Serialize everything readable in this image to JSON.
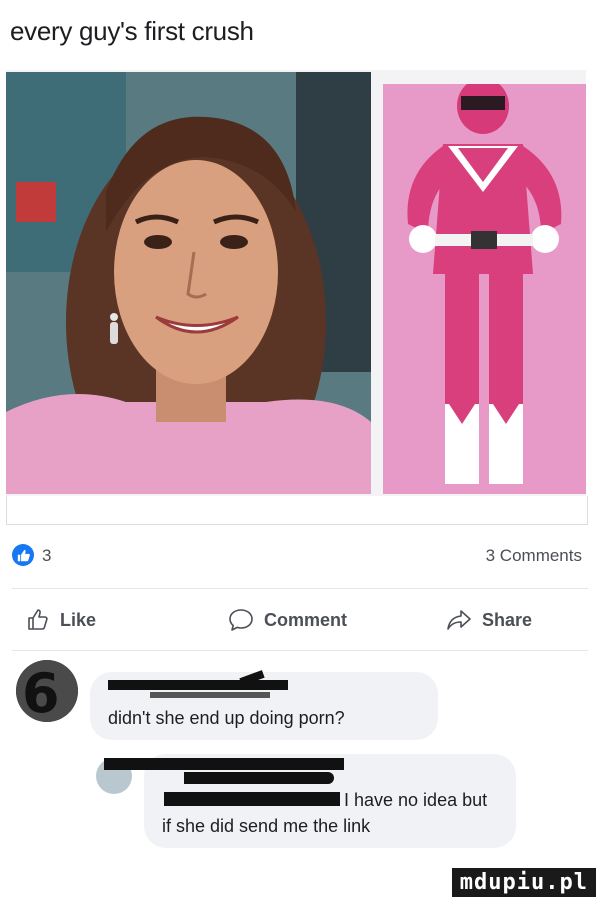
{
  "post": {
    "caption": "every guy's first crush"
  },
  "stats": {
    "like_count": "3",
    "comments_label": "3 Comments"
  },
  "actions": {
    "like_label": "Like",
    "comment_label": "Comment",
    "share_label": "Share"
  },
  "comments": [
    {
      "text": "didn't she end up doing porn?"
    },
    {
      "text_line1": "I have no idea but",
      "text_line2": "if she did send me the link"
    }
  ],
  "icons": {
    "like_badge": "thumbs-up-icon",
    "like_action": "thumbs-up-outline-icon",
    "comment_action": "speech-bubble-icon",
    "share_action": "share-arrow-icon"
  },
  "colors": {
    "facebook_blue": "#1877f2",
    "bubble_bg": "#f0f2f5",
    "ranger_pink": "#e0457f"
  },
  "watermark": "mdupiu.pl"
}
